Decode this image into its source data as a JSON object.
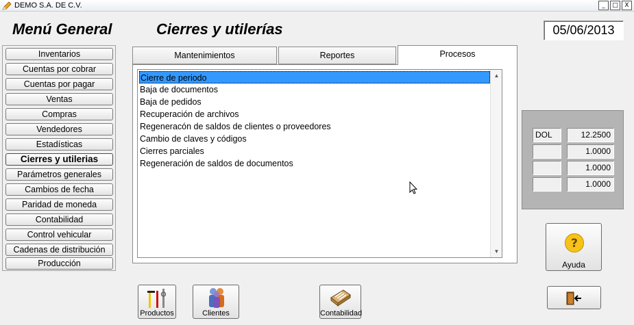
{
  "window": {
    "title": "DEMO  S.A. DE C.V.",
    "controls": [
      "_",
      "□",
      "X"
    ]
  },
  "header": {
    "menu_title": "Menú General",
    "section_title": "Cierres y utilerías",
    "date": "05/06/2013"
  },
  "sidebar": {
    "items": [
      {
        "label": "Inventarios"
      },
      {
        "label": "Cuentas por cobrar"
      },
      {
        "label": "Cuentas por pagar"
      },
      {
        "label": "Ventas"
      },
      {
        "label": "Compras"
      },
      {
        "label": "Vendedores"
      },
      {
        "label": "Estadísticas"
      },
      {
        "label": "Cierres y utilerias",
        "active": true
      },
      {
        "label": "Parámetros generales"
      },
      {
        "label": "Cambios de fecha"
      },
      {
        "label": "Paridad de moneda"
      },
      {
        "label": "Contabilidad"
      },
      {
        "label": "Control vehicular"
      },
      {
        "label": "Cadenas de distribución"
      },
      {
        "label": "Producción"
      }
    ]
  },
  "tabs": [
    {
      "label": "Mantenimientos"
    },
    {
      "label": "Reportes"
    },
    {
      "label": "Procesos",
      "active": true
    }
  ],
  "process_list": [
    {
      "label": "Cierre de periodo",
      "selected": true
    },
    {
      "label": "Baja de documentos"
    },
    {
      "label": "Baja de pedidos"
    },
    {
      "label": "Recuperación de archivos"
    },
    {
      "label": "Regeneracón de saldos de clientes o proveedores"
    },
    {
      "label": "Cambio de claves y códigos"
    },
    {
      "label": "Cierres parciales"
    },
    {
      "label": "Regeneración de saldos de documentos"
    }
  ],
  "currency_rates": [
    {
      "code": "DOL",
      "rate": "12.2500"
    },
    {
      "code": "",
      "rate": "1.0000"
    },
    {
      "code": "",
      "rate": "1.0000"
    },
    {
      "code": "",
      "rate": "1.0000"
    }
  ],
  "buttons": {
    "help": "Ayuda",
    "products": "Productos",
    "clients": "Clientes",
    "accounting": "Contabilidad"
  },
  "icons": {
    "app": "pencil-icon",
    "help": "question-icon",
    "exit": "exit-door-icon",
    "products": "tools-icon",
    "clients": "people-icon",
    "accounting": "file-box-icon"
  },
  "colors": {
    "selection": "#3399ff",
    "currency_panel": "#b4b4b4",
    "help_icon": "#f5b800"
  }
}
